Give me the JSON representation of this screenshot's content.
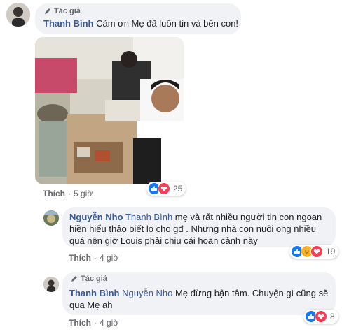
{
  "colors": {
    "like_blue": "#1877f2",
    "love_red": "#f33e58",
    "haha_yellow": "#f7b125",
    "name_blue": "#385898",
    "bubble": "#f0f2f5"
  },
  "comment1": {
    "author_tag": "Tác giả",
    "author": "Thanh Bình",
    "text": "Cảm ơn Mẹ đã luôn tin và bên con!",
    "like_label": "Thích",
    "time": "5 giờ",
    "reactions": [
      "like-icon",
      "love-icon"
    ],
    "reaction_count": "25"
  },
  "reply1": {
    "author": "Nguyễn Nho",
    "mention": "Thanh Bình",
    "text_line1": "mẹ và rất nhiều người tin con ngoan",
    "text_line2": "hiền hiểu thảo biết lo cho gđ . Nhưng nhà con nuôi ong nhiều",
    "text_line3": "quá nên giờ Louis phải chịu cái hoàn cảnh này",
    "like_label": "Thích",
    "time": "4 giờ",
    "reactions": [
      "like-icon",
      "sad-icon",
      "love-icon"
    ],
    "reaction_count": "19"
  },
  "reply2": {
    "author_tag": "Tác giả",
    "author": "Thanh Bình",
    "mention": "Nguyễn Nho",
    "text_line1": "Mẹ đừng bận tâm. Chuyện gì cũng sẽ",
    "text_line2": "qua Mẹ ah",
    "like_label": "Thích",
    "time": "4 giờ",
    "reactions": [
      "like-icon",
      "love-icon"
    ],
    "reaction_count": "8"
  }
}
